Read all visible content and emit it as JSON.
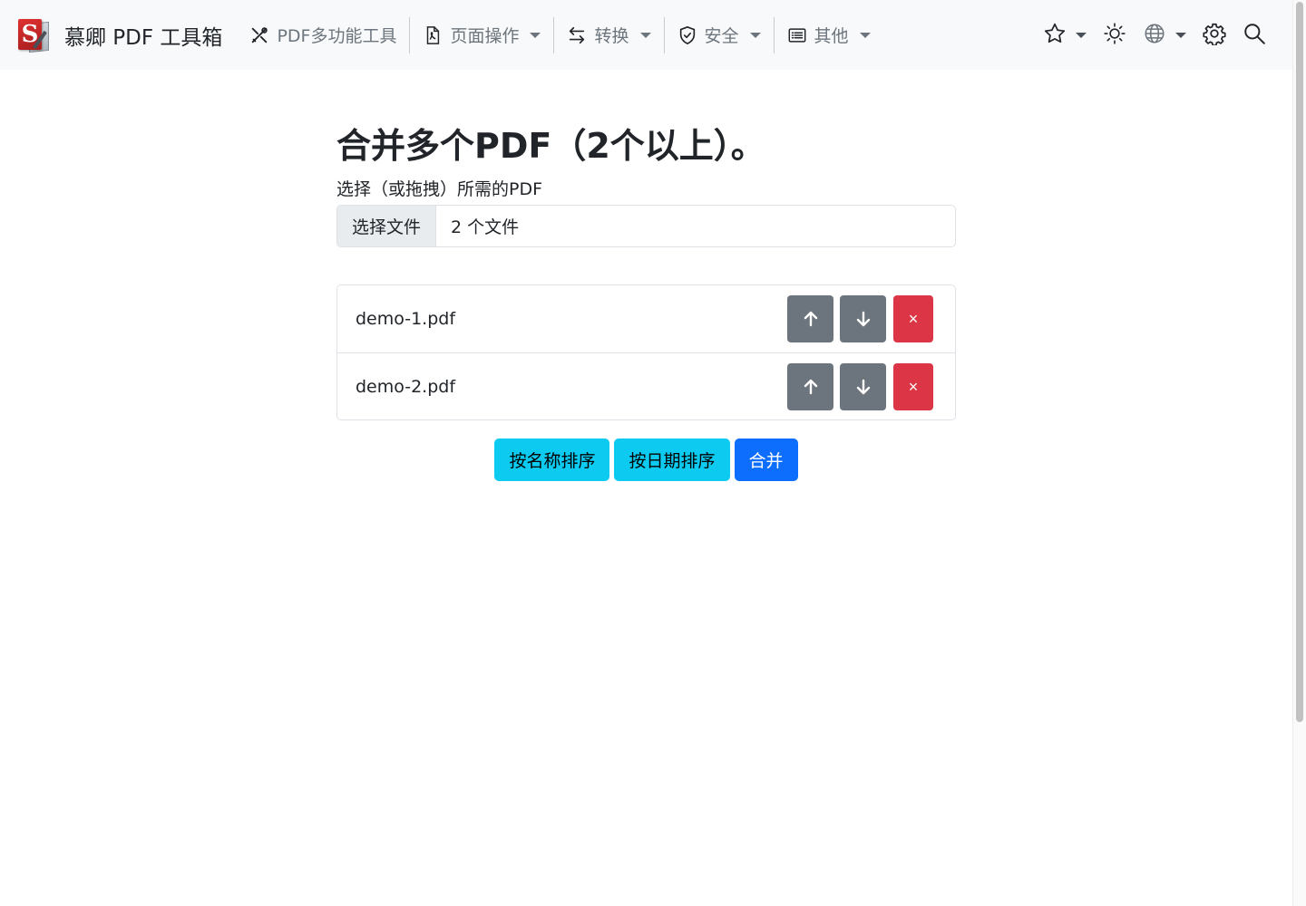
{
  "brand": {
    "logo_letter": "S",
    "title": "慕卿 PDF 工具箱"
  },
  "nav": {
    "items": [
      {
        "label": "PDF多功能工具",
        "icon": "tools-icon",
        "dropdown": false
      },
      {
        "label": "页面操作",
        "icon": "file-pdf-icon",
        "dropdown": true
      },
      {
        "label": "转换",
        "icon": "arrows-exchange-icon",
        "dropdown": true
      },
      {
        "label": "安全",
        "icon": "shield-check-icon",
        "dropdown": true
      },
      {
        "label": "其他",
        "icon": "list-card-icon",
        "dropdown": true
      }
    ],
    "right": [
      {
        "icon": "star-icon",
        "dropdown": true
      },
      {
        "icon": "sun-icon",
        "dropdown": false
      },
      {
        "icon": "globe-icon",
        "dropdown": true
      },
      {
        "icon": "gear-icon",
        "dropdown": false
      },
      {
        "icon": "search-icon",
        "dropdown": false
      }
    ]
  },
  "main": {
    "title": "合并多个PDF（2个以上）。",
    "file_label": "选择（或拖拽）所需的PDF",
    "file_button": "选择文件",
    "file_status": "2 个文件",
    "files": [
      {
        "name": "demo-1.pdf"
      },
      {
        "name": "demo-2.pdf"
      }
    ],
    "row_actions": {
      "up_icon": "arrow-up-icon",
      "down_icon": "arrow-down-icon",
      "remove_label": "×"
    },
    "sort_by_name": "按名称排序",
    "sort_by_date": "按日期排序",
    "merge": "合并"
  },
  "colors": {
    "navbar_bg": "#f8f9fa",
    "secondary": "#6c757d",
    "danger": "#dc3545",
    "info": "#0dcaf0",
    "primary": "#0d6efd"
  }
}
